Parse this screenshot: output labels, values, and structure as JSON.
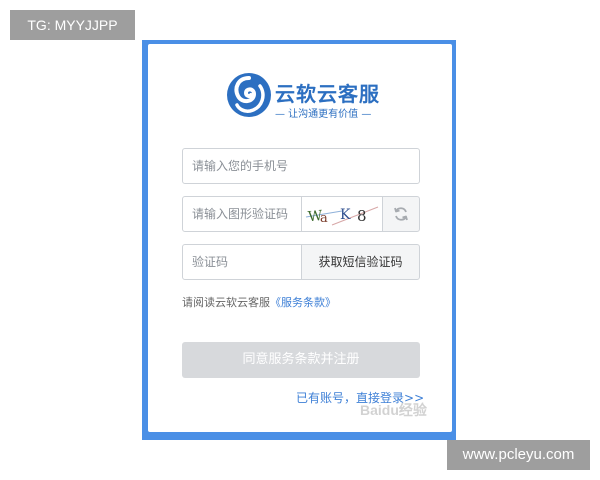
{
  "overlay": {
    "tag_label": "TG: MYYJJPP",
    "site_watermark": "www.pcleyu.com",
    "baidu_watermark": "Baidu经验"
  },
  "brand": {
    "name": "云软云客服",
    "slogan": "— 让沟通更有价值 —",
    "logo_icon": "swirl-logo-icon",
    "color": "#2c6fc1"
  },
  "form": {
    "phone": {
      "placeholder": "请输入您的手机号",
      "value": ""
    },
    "captcha": {
      "placeholder": "请输入图形验证码",
      "value": "",
      "image_text": "Wa K 8"
    },
    "refresh_icon": "refresh-icon",
    "sms_code": {
      "placeholder": "验证码",
      "value": "",
      "button_label": "获取短信验证码"
    },
    "terms": {
      "prefix": "请阅读云软云客服",
      "link": "《服务条款》"
    },
    "submit_label": "同意服务条款并注册",
    "login": {
      "prefix": "已有账号，",
      "link": "直接登录>>"
    }
  },
  "colors": {
    "frame": "#4a8fe6",
    "link": "#3d7fd6",
    "submit_disabled": "#d7d9dc"
  }
}
